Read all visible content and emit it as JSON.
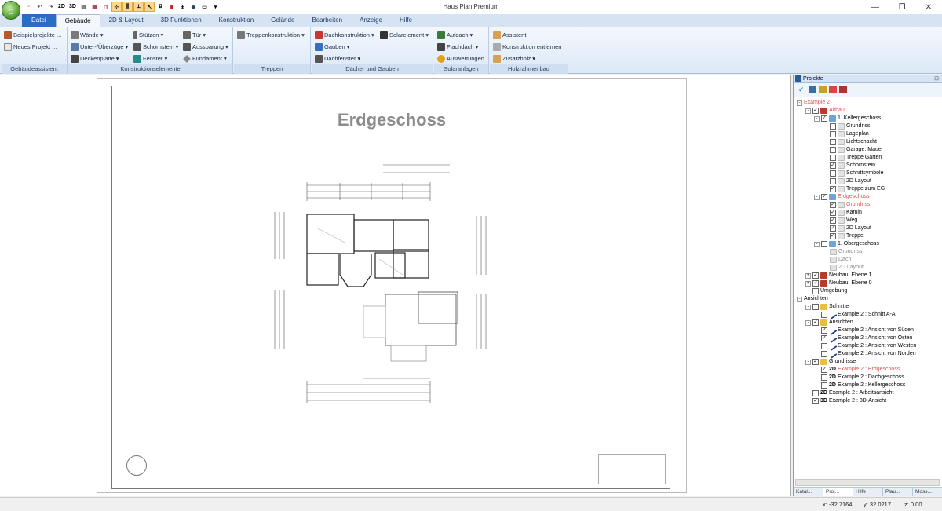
{
  "app": {
    "title": "Haus Plan Premium"
  },
  "quick_access": [
    "2D",
    "3D"
  ],
  "tabs": [
    "Datei",
    "Gebäude",
    "2D & Layout",
    "3D Funktionen",
    "Konstruktion",
    "Gelände",
    "Bearbeiten",
    "Anzeige",
    "Hilfe"
  ],
  "ribbon": {
    "gebaeudeassistent": {
      "label": "Gebäudeassistent",
      "beispiel": "Beispielprojekte ...",
      "neues": "Neues Projekt ..."
    },
    "konstruktion": {
      "label": "Konstruktionselemente",
      "waende": "Wände",
      "unter": "Unter-/Überzüge",
      "decken": "Deckenplatte",
      "stuetzen": "Stützen",
      "schornstein": "Schornstein",
      "fenster": "Fenster",
      "tuer": "Tür",
      "aussparung": "Aussparung",
      "fundament": "Fundament"
    },
    "treppen": {
      "label": "Treppen",
      "treppenkonstruktion": "Treppenkonstruktion"
    },
    "daecher": {
      "label": "Dächer und Gauben",
      "dachkonstruktion": "Dachkonstruktion",
      "solarelement": "Solarelement",
      "gauben": "Gauben",
      "dachfenster": "Dachfenster"
    },
    "solar": {
      "label": "Solaranlagen",
      "aufdach": "Aufdach",
      "flachdach": "Flachdach",
      "auswertungen": "Auswertungen"
    },
    "holz": {
      "label": "Holzrahmenbau",
      "assistent": "Assistent",
      "entfernen": "Konstruktion entfernen",
      "zusatzholz": "Zusatzholz"
    }
  },
  "drawing": {
    "title": "Erdgeschoss"
  },
  "panel": {
    "title": "Projekte",
    "tree": [
      {
        "label": "Example 2",
        "indent": 0,
        "exp": "-",
        "color": "red"
      },
      {
        "label": "Altbau",
        "indent": 1,
        "exp": "-",
        "cb": "✓",
        "icon": "house",
        "color": "red"
      },
      {
        "label": "1. Kellergeschoss",
        "indent": 2,
        "exp": "-",
        "cb": "✓",
        "icon": "floor"
      },
      {
        "label": "Grundriss",
        "indent": 3,
        "cb": "",
        "icon": "page"
      },
      {
        "label": "Lageplan",
        "indent": 3,
        "cb": "",
        "icon": "page"
      },
      {
        "label": "Lichtschacht",
        "indent": 3,
        "cb": "",
        "icon": "page"
      },
      {
        "label": "Garage, Mauer",
        "indent": 3,
        "cb": "",
        "icon": "page"
      },
      {
        "label": "Treppe Garten",
        "indent": 3,
        "cb": "",
        "icon": "page"
      },
      {
        "label": "Schornstein",
        "indent": 3,
        "cb": "✓",
        "icon": "page"
      },
      {
        "label": "Schnittsymbole",
        "indent": 3,
        "cb": "",
        "icon": "page"
      },
      {
        "label": "2D Layout",
        "indent": 3,
        "cb": "",
        "icon": "page"
      },
      {
        "label": "Treppe zum EG",
        "indent": 3,
        "cb": "✓",
        "icon": "page"
      },
      {
        "label": "Erdgeschoss",
        "indent": 2,
        "exp": "-",
        "cb": "✓",
        "icon": "floor",
        "color": "red"
      },
      {
        "label": "Grundriss",
        "indent": 3,
        "cb": "✓",
        "icon": "page",
        "color": "red"
      },
      {
        "label": "Kamin",
        "indent": 3,
        "cb": "✓",
        "icon": "page"
      },
      {
        "label": "Weg",
        "indent": 3,
        "cb": "✓",
        "icon": "page"
      },
      {
        "label": "2D Layout",
        "indent": 3,
        "cb": "✓",
        "icon": "page"
      },
      {
        "label": "Treppe",
        "indent": 3,
        "cb": "✓",
        "icon": "page"
      },
      {
        "label": "1. Obergeschoss",
        "indent": 2,
        "exp": "-",
        "cb": "",
        "icon": "floor"
      },
      {
        "label": "Grundriss",
        "indent": 3,
        "icon": "page",
        "color": "gray"
      },
      {
        "label": "Dach",
        "indent": 3,
        "icon": "page",
        "color": "gray"
      },
      {
        "label": "2D Layout",
        "indent": 3,
        "icon": "page",
        "color": "gray"
      },
      {
        "label": "Neubau, Ebene 1",
        "indent": 1,
        "exp": "+",
        "cb": "✓",
        "icon": "house"
      },
      {
        "label": "Neubau, Ebene 0",
        "indent": 1,
        "exp": "+",
        "cb": "✓",
        "icon": "house"
      },
      {
        "label": "Umgebung",
        "indent": 1,
        "cb": ""
      },
      {
        "label": "Ansichten",
        "indent": 0,
        "exp": "-"
      },
      {
        "label": "Schnitte",
        "indent": 1,
        "exp": "-",
        "cb": "",
        "icon": "folder"
      },
      {
        "label": "Example 2 : Schnitt A-A",
        "indent": 2,
        "cb": "",
        "icon": "line"
      },
      {
        "label": "Ansichten",
        "indent": 1,
        "exp": "-",
        "cb": "✓",
        "icon": "folder"
      },
      {
        "label": "Example 2 : Ansicht von Süden",
        "indent": 2,
        "cb": "✓",
        "icon": "line"
      },
      {
        "label": "Example 2 : Ansicht von Osten",
        "indent": 2,
        "cb": "✓",
        "icon": "line"
      },
      {
        "label": "Example 2 : Ansicht von Westen",
        "indent": 2,
        "cb": "",
        "icon": "line"
      },
      {
        "label": "Example 2 : Ansicht von Norden",
        "indent": 2,
        "cb": "",
        "icon": "line"
      },
      {
        "label": "Grundrisse",
        "indent": 1,
        "exp": "-",
        "cb": "✓",
        "icon": "folder"
      },
      {
        "label": "Example 2 : Erdgeschoss",
        "indent": 2,
        "cb": "✓",
        "badge": "2D",
        "color": "red"
      },
      {
        "label": "Example 2 : Dachgeschoss",
        "indent": 2,
        "cb": "",
        "badge": "2D"
      },
      {
        "label": "Example 2 : Kellergeschoss",
        "indent": 2,
        "cb": "",
        "badge": "2D"
      },
      {
        "label": "Example 2 : Arbeitsansicht",
        "indent": 1,
        "cb": "",
        "badge": "2D"
      },
      {
        "label": "Example 2 : 3D-Ansicht",
        "indent": 1,
        "cb": "✓",
        "badge": "3D"
      }
    ],
    "bottom_tabs": [
      "Katal...",
      "Proj...",
      "Hilfe",
      "Plau...",
      "Moss..."
    ]
  },
  "status": {
    "x": "x: -32.7164",
    "y": "y: 32.0217",
    "z": "z: 0.00"
  }
}
